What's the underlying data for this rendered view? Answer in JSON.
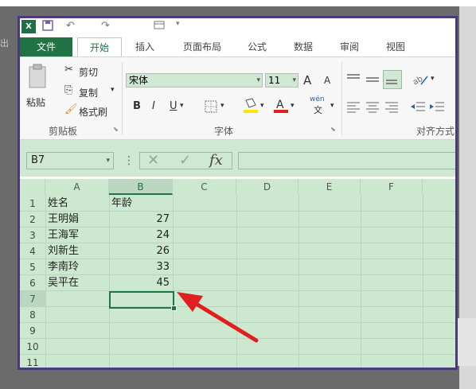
{
  "quick_access": {
    "undo": "↶",
    "redo": "↷",
    "more": "▾"
  },
  "ribbon_tabs": [
    "文件",
    "开始",
    "插入",
    "页面布局",
    "公式",
    "数据",
    "审阅",
    "视图"
  ],
  "clipboard": {
    "paste": "粘贴",
    "cut": "剪切",
    "copy": "复制",
    "format_painter": "格式刷",
    "group": "剪贴板"
  },
  "font": {
    "name": "宋体",
    "size": "11",
    "group": "字体",
    "bold": "B",
    "italic": "I",
    "underline": "U",
    "grow": "A",
    "shrink": "A",
    "wen": "wén",
    "wen_sub": "文"
  },
  "alignment": {
    "group": "对齐方式"
  },
  "formula_bar": {
    "name_box": "B7",
    "fx": "fx",
    "dots": "⋮",
    "cancel": "✕",
    "confirm": "✓"
  },
  "columns": [
    "A",
    "B",
    "C",
    "D",
    "E",
    "F"
  ],
  "rows": [
    "1",
    "2",
    "3",
    "4",
    "5",
    "6",
    "7",
    "8",
    "9",
    "10",
    "11"
  ],
  "table": {
    "header": {
      "name": "姓名",
      "age": "年龄"
    },
    "people": [
      {
        "name": "王明娟",
        "age": "27"
      },
      {
        "name": "王海军",
        "age": "24"
      },
      {
        "name": "刘新生",
        "age": "26"
      },
      {
        "name": "李南玲",
        "age": "33"
      },
      {
        "name": "吴平在",
        "age": "45"
      }
    ]
  },
  "selected_cell": "B7",
  "colors": {
    "excel_green": "#217346",
    "eye_care_green": "#cce8cf",
    "arrow_red": "#e02020",
    "frame_purple": "#4b3a7a"
  },
  "side_ghost_text": "出"
}
